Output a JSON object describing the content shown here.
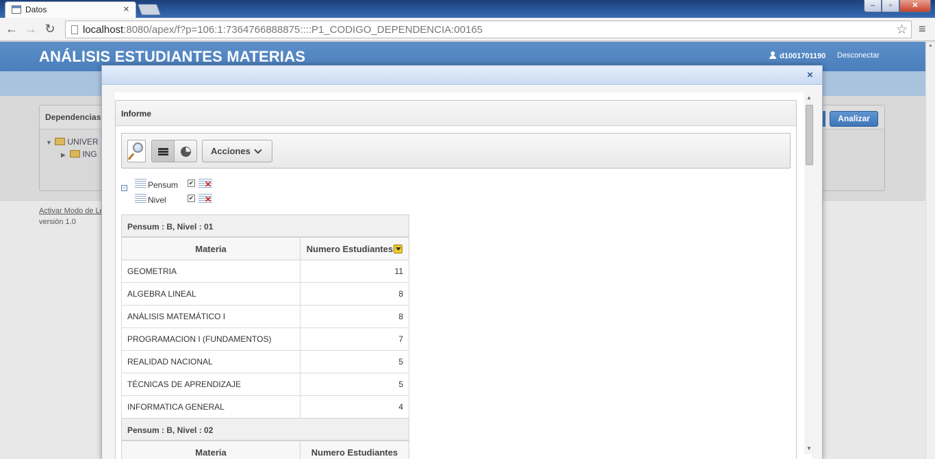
{
  "browser": {
    "tab_title": "Datos",
    "tab_close": "×",
    "url_host": "localhost",
    "url_rest": ":8080/apex/f?p=106:1:7364766888875::::P1_CODIGO_DEPENDENCIA:00165",
    "menu_glyph": "≡"
  },
  "app": {
    "title": "ANÁLISIS ESTUDIANTES MATERIAS",
    "user": "d1001701190",
    "logout": "Desconectar"
  },
  "dependencias": {
    "title": "Dependencias",
    "tree": [
      {
        "label": "UNIVER"
      },
      {
        "label": "ING"
      }
    ],
    "analizar": "Analizar"
  },
  "footer": {
    "link": "Activar Modo de Le",
    "version": "versión 1.0"
  },
  "dialog": {
    "close": "×",
    "region_title": "Informe",
    "acciones": "Acciones",
    "controls": [
      {
        "label": "Pensum"
      },
      {
        "label": "Nivel"
      }
    ],
    "groups": [
      {
        "heading": "Pensum : B, Nivel : 01",
        "col_materia": "Materia",
        "col_numero": "Numero Estudiantes",
        "rows": [
          {
            "materia": "GEOMETRIA",
            "numero": "11"
          },
          {
            "materia": "ALGEBRA LINEAL",
            "numero": "8"
          },
          {
            "materia": "ANÁLISIS MATEMÁTICO I",
            "numero": "8"
          },
          {
            "materia": "PROGRAMACION I (FUNDAMENTOS)",
            "numero": "7"
          },
          {
            "materia": "REALIDAD NACIONAL",
            "numero": "5"
          },
          {
            "materia": "TÉCNICAS DE APRENDIZAJE",
            "numero": "5"
          },
          {
            "materia": "INFORMATICA GENERAL",
            "numero": "4"
          }
        ]
      },
      {
        "heading": "Pensum : B, Nivel : 02",
        "col_materia": "Materia",
        "col_numero": "Numero Estudiantes",
        "rows": []
      }
    ]
  },
  "colors": {
    "header_blue": "#4a7fbd",
    "subbar_blue": "#a9c3df",
    "button_blue": "#3f76b8",
    "sort_yellow": "#f3cc2f",
    "remove_red": "#d21f1f"
  },
  "icons": [
    "page-icon",
    "star-icon",
    "user-icon",
    "folder-icon",
    "search-icon",
    "report-view-icon",
    "chart-view-icon",
    "chevron-down-icon",
    "control-break-icon",
    "remove-break-icon",
    "sort-descending-icon",
    "close-icon"
  ]
}
